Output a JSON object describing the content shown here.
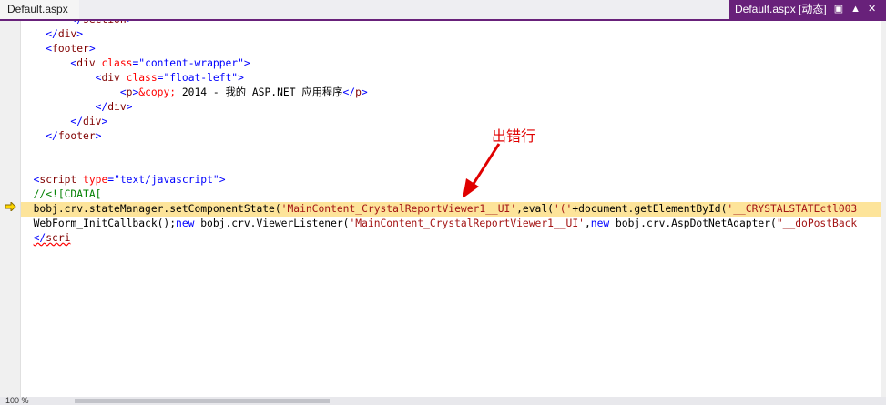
{
  "tabs": {
    "left_title": "Default.aspx",
    "right_title": "Default.aspx [动态]",
    "right_icons": [
      "lock-icon",
      "pin-icon",
      "close-icon"
    ]
  },
  "annotation": {
    "text": "出错行",
    "color": "#e00000"
  },
  "code_lines": [
    "        </section>",
    "    </div>",
    "    <footer>",
    "        <div class=\"content-wrapper\">",
    "            <div class=\"float-left\">",
    "                <p>&copy; 2014 - 我的 ASP.NET 应用程序</p>",
    "            </div>",
    "        </div>",
    "    </footer>",
    "",
    "",
    "<script type=\"text/javascript\">",
    "//<![CDATA[",
    "bobj.crv.stateManager.setComponentState('MainContent_CrystalReportViewer1__UI',eval('('+document.getElementById('__CRYSTALSTATEctl003",
    "WebForm_InitCallback();new bobj.crv.ViewerListener('MainContent_CrystalReportViewer1__UI',new bobj.crv.AspDotNetAdapter(\"__doPostBack",
    "</scri"
  ],
  "highlighted_line": 13,
  "status": {
    "zoom": "100 %"
  },
  "colors": {
    "accent": "#68217a",
    "highlight": "#fde49a",
    "annotation": "#e00000"
  }
}
